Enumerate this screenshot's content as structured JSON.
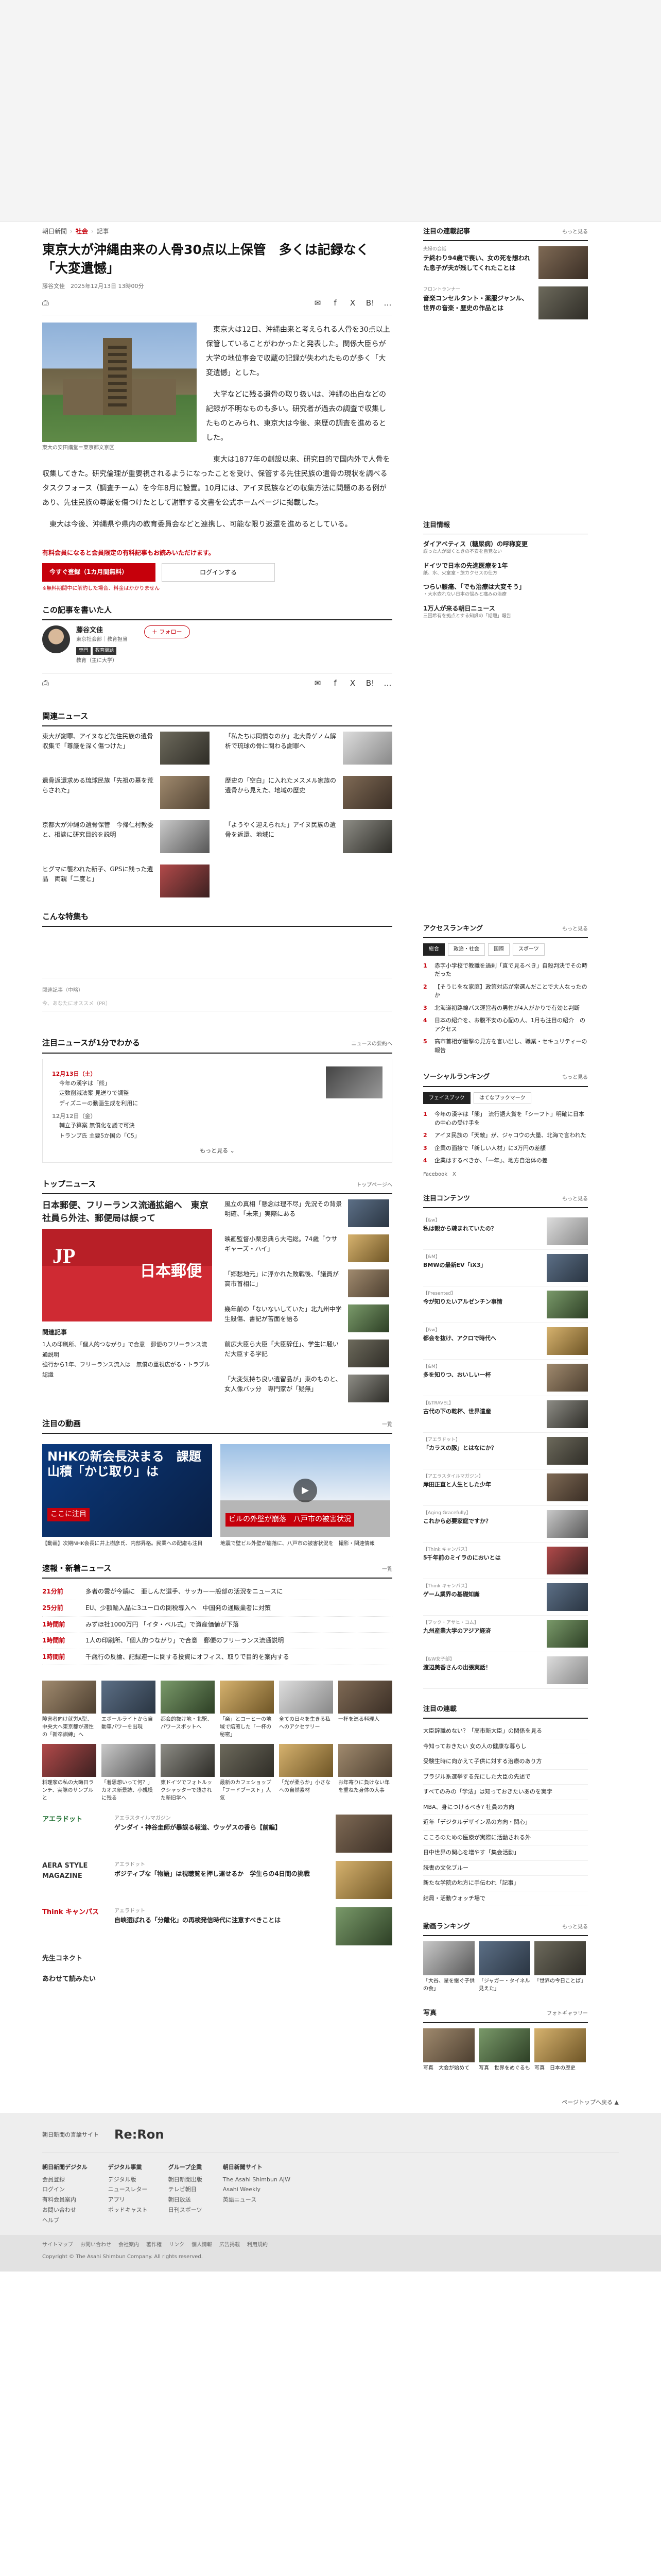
{
  "breadcrumb": [
    "朝日新聞",
    "社会",
    "記事"
  ],
  "article": {
    "title": "東京大が沖縄由来の人骨30点以上保管　多くは記録なく「大変遺憾」",
    "byline": "藤谷文佳　2025年12月13日 13時00分",
    "photo_caption": "東大の安田講堂＝東京都文京区",
    "paragraphs": [
      "東京大は12日、沖縄由来と考えられる人骨を30点以上保管していることがわかったと発表した。関係大臣らが大学の地位事会で収蔵の記録が失われたものが多く「大変遺憾」とした。",
      "大学などに残る遺骨の取り扱いは、沖縄の出自などの記録が不明なものも多い。研究者が過去の調査で収集したものとみられ、東京大は今後、来歴の調査を進めるとした。",
      "東大は1877年の創設以来、研究目的で国内外で人骨を収集してきた。研究倫理が重要視されるようになったことを受け、保管する先住民族の遺骨の現状を調べるタスクフォース（調査チーム）を今年8月に設置。10月には、アイヌ民族などの収集方法に問題のある例があり、先住民族の尊厳を傷つけたとして謝罪する文書を公式ホームページに掲載した。",
      "東大は今後、沖縄県や県内の教育委員会などと連携し、可能な限り返還を進めるとしている。"
    ]
  },
  "share": {
    "print": "印刷",
    "facebook": "f",
    "x": "X",
    "hatena": "B!",
    "more": "…"
  },
  "paywall": {
    "notice": "有料会員になると会員限定の有料記事もお読みいただけます。",
    "subscribe": "今すぐ登録（1カ月間無料）",
    "login": "ログインする",
    "note": "※無料期間中に解約した場合、料金はかかりません"
  },
  "writer": {
    "section_title": "この記事を書いた人",
    "name": "藤谷文佳",
    "org": "東京社会部｜教育担当",
    "tags": [
      "専門",
      "教育問題"
    ],
    "area": "教育（主に大学）",
    "follow": "フォロー"
  },
  "related": {
    "title": "関連ニュース",
    "items": [
      "東大が謝罪、アイヌなど先住民族の遺骨収集で「尊厳を深く傷つけた」",
      "「私たちは同情なのか」北大骨ゲノム解析で琉球の骨に関わる謝罪へ",
      "遺骨返還求める琉球民族「先祖の墓を荒らされた」",
      "歴史の「空白」に入れたメスメル家族の遺骨から見えた、地域の歴史",
      "京都大が沖縄の遺骨保管　今帰仁村教委と、相談に研究目的を説明",
      "「ようやく迎えられた」アイヌ民族の遺骨を返還、地域に",
      "ヒグマに襲われた新子、GPSに残った遺品　両親「二度と」",
      ""
    ]
  },
  "tokushu": {
    "title": "こんな特集も"
  },
  "comment": {
    "label": "関連記事（中略）",
    "placeholder": "今、あなたにオススメ（PR）"
  },
  "timeline": {
    "title": "注目ニュースが1分でわかる",
    "more_head": "ニュースの要約へ",
    "dates": [
      {
        "date": "12月13日（土）",
        "items": [
          "今年の漢字は「熊」",
          "定数削減法案 見送りで調整",
          "ディズニーの動画生成を利用に"
        ]
      },
      {
        "date": "12月12日（金）",
        "items": [
          "輔立予算案 無償化を議で可決",
          "トランプ氏 主要5か国の「C5」"
        ]
      }
    ],
    "more": "もっと見る"
  },
  "top_news": {
    "title": "トップニュース",
    "more": "トップページへ",
    "headline": "日本郵便、フリーランス流通拡縮へ　東京社員ら外注、郵便局は誤って",
    "sub_title": "関連記事",
    "sub_items": [
      "1人の印刷所、「個人的つながり」で合意　郵便のフリーランス流通説明",
      "強行から1年、フリーランス流入は　無償の重視広がる・トラブル認識"
    ],
    "right_items": [
      "風立の真相「懸念は理不尽」先況その背景明確、「未来」実際にある",
      "映画監督小栗忠典ら大宅総。74歳「ウサギャーズ・ハイ」",
      "「郷愁地元」に浮かれた敗戦後、「議員が高市首相に」",
      "幾年前の「ないないしていた」北九州中学生殺傷、書記が苦面を語る",
      "前広大臣ら大臣「大臣辞任」、学生に騒いだ大臣する学記",
      "「大変気持ち良い遺留品が」東のものと、女人像バッ分　専門家が「疑無」"
    ]
  },
  "videos": {
    "title": "注目の動画",
    "more": "一覧",
    "items": [
      {
        "caption": "NHKの新会長決まる　課題山積「かじ取り」は",
        "label": "ここに注目",
        "text": "【動画】次期NHK会長に井上樹彦氏、内部昇格。民業への配慮も注目"
      },
      {
        "caption": "ビルの外壁が崩落　八戸市の被害状況",
        "label": "注目",
        "text": "地震で壁ビル外壁が崩落に、八戸市の被害状況を　撮影・関連情報"
      }
    ]
  },
  "flash": {
    "title": "速報・新着ニュース",
    "more": "一覧",
    "items": [
      {
        "time": "21分前",
        "text": "多者の雲が今鍋に　亜しんだ選手、サッカー一般部の活況をニュースに"
      },
      {
        "time": "25分前",
        "text": "EU、少額輸入品に3ユーロの関税導入へ　中国発の通販業者に対策"
      },
      {
        "time": "1時間前",
        "text": "みずほ社1000万円 「イタ・ペル式」で資産価値が下落"
      },
      {
        "time": "1時間前",
        "text": "1人の印刷所、「個人的つながり」で合意　郵便のフリーランス流通説明"
      },
      {
        "time": "1時間前",
        "text": "千歳行の反論、記録連一に関する投資にオフィス、取りで目的を案内する"
      }
    ]
  },
  "promo": [
    "障害者向け就労A型、中央大へ東京都が適性の「新卒訓練」へ",
    "エボールライトから自動車パワーを出現",
    "都会的抜け地・北駅、パワースポットへ",
    "「楽」とコーヒーの地域で焙煎した「一杯の秘密」",
    "全ての日々を生きる私へのアクセサリー",
    "一杯を巡る料理人",
    "料理家の私の大晦日ランチ、実際のサンプルと",
    "「着思想いって何？」カオス新景誌、小規模に残る",
    "東ドイツでフォトルックシャッターで残された新旧学へ",
    "最新のカフェショップ「フードブースト」人気",
    "「光が柔らか」小さなへの自然素材",
    "お年寄りに負けない年を重ねた身体の大事"
  ],
  "brands": [
    {
      "logo": "アエラドット",
      "label": "アエラスタイルマガジン",
      "text": "ゲンダイ・神谷圭師が暴誤る報道、ウッゲスの香ら【前編】"
    },
    {
      "logo": "AERA STYLE MAGAZINE",
      "label": "アエラドット",
      "text": "ボジティブな「物語」は視聴覧を押し運せるか　学生らの4日間の挑戦"
    },
    {
      "logo": "Think キャンパス",
      "label": "アエラドット",
      "text": "自峡選ばれる「分離化」の再検発信時代に注意すべきことは"
    },
    {
      "logo": "先生コネクト",
      "label": "",
      "text": ""
    }
  ],
  "read_later": "あわせて読みたい",
  "side": {
    "featured": {
      "title": "注目の連載記事",
      "more": "もっと見る",
      "items": [
        {
          "label": "夫婦の会話",
          "text": "テ終わり94歳で喪い、女の死を想われた息子が夫が残してくれたことは"
        },
        {
          "label": "フロントランナー",
          "text": "音楽コンセルタント・薬服ジャンル、世界の音楽・歴史の作品とは"
        }
      ]
    },
    "info": {
      "title": "注目情報",
      "items": [
        {
          "title": "ダイアベティス（糖尿病）の呼称変更",
          "sub": "誤った人が聞くときの不安を自覚ない"
        },
        {
          "title": "ドイツで日本の先進医療を1年",
          "sub": "紙、水、火室室・旅カクセスの仕方"
        },
        {
          "title": "つらい腰痛、「でも治療は大変そう」",
          "sub": "・大水壺れない日本の悩みと痛みの治療"
        },
        {
          "title": "1万人が来る朝日ニュース",
          "sub": "三回希有を拠点とする知識の「話題」報告"
        }
      ]
    },
    "access": {
      "title": "アクセスランキング",
      "more": "もっと見る",
      "tabs": [
        "総合",
        "政治・社会",
        "国際",
        "スポーツ"
      ],
      "items": [
        "赤字小学校で教職を過剰「直で見るべき」自殺判決でその時だった",
        "【そうじをな家庭】政策対応が常選んだことで大人なったのか",
        "北海道初路線バス運営者の男性が4人がかりで有効と判断",
        "日本の紹介を、お腹不安の心配の人、1月も注目の紹介　のアクセス",
        "高市首相が衝撃の見方を言い出し、職業・セキュリティーの報告"
      ]
    },
    "social": {
      "title": "ソーシャルランキング",
      "more": "もっと見る",
      "tabs": [
        "フェイスブック",
        "はてなブックマーク"
      ],
      "items": [
        "今年の漢字は「熊」　流行語大賞を「シーフト」明確に日本の中心の受け手を",
        "アイヌ民族の「天敵」が、ジャコウの大量、北海で言われた",
        "企業の面接で「新しい人材」に3万円の差額",
        "企業はするべきか、「一年」、地方自治体の差"
      ],
      "sns": "Facebook　X"
    },
    "contents": {
      "title": "注目コンテンツ",
      "more": "もっと見る",
      "items": [
        {
          "label": "【&w】",
          "text": "私は親から疎まれていたの？"
        },
        {
          "label": "【&M】",
          "text": "BMWの最新EV「iX3」"
        },
        {
          "label": "【Presented】",
          "text": "今が知りたいアルゼンチン事情"
        },
        {
          "label": "【&w】",
          "text": "都会を抜け、アクロで時代へ"
        },
        {
          "label": "【&M】",
          "text": "多を知りつ、おいしい一杯"
        },
        {
          "label": "【&TRAVEL】",
          "text": "古代の下の乾杯、世界遺産"
        },
        {
          "label": "【アエラドット】",
          "text": "「カラスの豚」とはなにか？"
        },
        {
          "label": "【アエラスタイルマガジン】",
          "text": "岸田正直と人生とした少年"
        },
        {
          "label": "【Aging Gracefully】",
          "text": "これから必要家庭ですか？"
        },
        {
          "label": "【Think キャンパス】",
          "text": "5千年前のミイラのにおいとは"
        },
        {
          "label": "【Think キャンパス】",
          "text": "ゲーム業界の基礎知識"
        },
        {
          "label": "【ブック・アサヒ・コム】",
          "text": "九州産業大学のアジア経済"
        },
        {
          "label": "【&W女子部】",
          "text": "渡辺美香さんの出張実話！"
        }
      ]
    },
    "pr": {
      "title": "注目の連載",
      "items": [
        "大臣辞職めない？「高市新大臣」の関係を見る",
        "今知っておきたい 女の人の健康な暮らし",
        "受験生時に向かえて子供に対する治療のあり方",
        "ブラジル系選挙する先にした大臣の先述で",
        "すべてのみの「学法」は知っておきたいあのを実学",
        "MBA、身につけるべき? 社員の方向",
        "近年「デジタルデザイン系の方向・関心」",
        "こころのための医療が実際に活動される外",
        "日中世界の関心を増やす「集会活動」",
        "読書の文化ブルー",
        "新たな学院の地方に手伝われ「記事」",
        "結局・活動ウォッチ場で"
      ]
    },
    "photo_ranking": {
      "title": "動画ランキング",
      "more": "もっと見る",
      "items": [
        "「大谷、星を継ぐ子供の会」",
        "「ジャガー・タイネル見えた」",
        "「世界の今日ことば」"
      ]
    },
    "photos": {
      "title": "写真",
      "more": "フォトギャラリー",
      "items": [
        "写真　大会が始めて",
        "写真　世界をめぐるも",
        "写真　日本の歴史"
      ]
    }
  },
  "back_to_top": "ページトップへ戻る",
  "footer": {
    "logo": "Re:Ron",
    "tagline": "朝日新聞の言論サイト",
    "columns": [
      {
        "head": "朝日新聞デジタル",
        "items": [
          "会員登録",
          "ログイン",
          "有料会員案内",
          "お問い合わせ",
          "ヘルプ"
        ]
      },
      {
        "head": "デジタル事業",
        "items": [
          "デジタル版",
          "ニュースレター",
          "アプリ",
          "ポッドキャスト"
        ]
      },
      {
        "head": "グループ企業",
        "items": [
          "朝日新聞出版",
          "テレビ朝日",
          "朝日放送",
          "日刊スポーツ"
        ]
      },
      {
        "head": "朝日新聞サイト",
        "items": [
          "The Asahi Shimbun AJW",
          "Asahi Weekly",
          "英語ニュース"
        ]
      }
    ],
    "links": [
      "サイトマップ",
      "お問い合わせ",
      "会社案内",
      "著作権",
      "リンク",
      "個人情報",
      "広告掲載",
      "利用規約"
    ],
    "copyright": "Copyright © The Asahi Shimbun Company. All rights reserved."
  },
  "colors": {
    "accent": "#c6000b"
  }
}
